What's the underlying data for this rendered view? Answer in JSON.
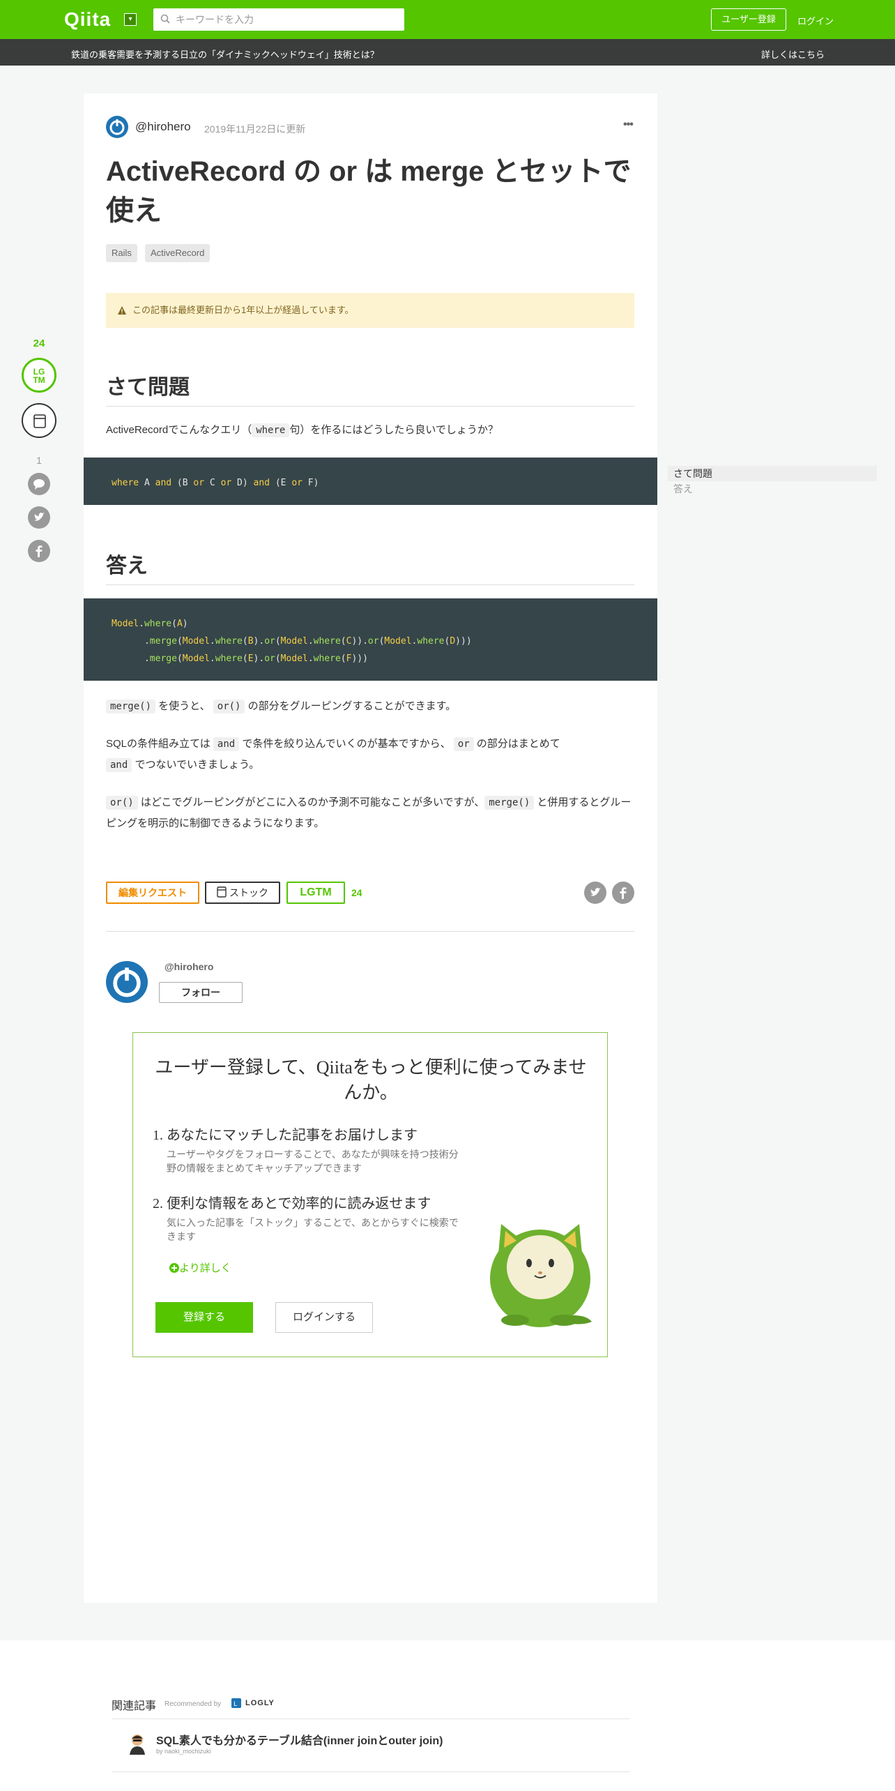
{
  "header": {
    "logo": "Qiita",
    "search_placeholder": "キーワードを入力",
    "signup_label": "ユーザー登録",
    "login_label": "ログイン",
    "brand_color": "#55c500"
  },
  "adbar": {
    "text": "鉄道の乗客需要を予測する日立の「ダイナミックヘッドウェイ」技術とは？",
    "link": "詳しくはこちら"
  },
  "rail": {
    "lgtm_count": "24",
    "lgtm_icon_text_1": "LG",
    "lgtm_icon_text_2": "TM",
    "comment_count": "1",
    "icons": [
      "comment-icon",
      "twitter-icon",
      "facebook-icon"
    ]
  },
  "article": {
    "author": "@hirohero",
    "updated": "2019年11月22日に更新",
    "more": "•••",
    "title": "ActiveRecord の or は merge とセットで使え",
    "tags": [
      "Rails",
      "ActiveRecord"
    ],
    "alert": "この記事は最終更新日から1年以上が経過しています。",
    "section1_heading": "さて問題",
    "section1_para": {
      "before": "ActiveRecordでこんなクエリ（",
      "code": "where",
      "after": "句）を作るにはどうしたら良いでしょうか？"
    },
    "code1": {
      "where": "where",
      "a": " A ",
      "and1": "and",
      "p1": " (B ",
      "or1": "or",
      "c": " C ",
      "or2": "or",
      "d": " D) ",
      "and2": "and",
      "p2": " (E ",
      "or3": "or",
      "f": " F)"
    },
    "section2_heading": "答え",
    "code2": {
      "model": "Model",
      "dot": ".",
      "where": "where",
      "merge": "merge",
      "or": "or",
      "a": "A",
      "b": "B",
      "c": "C",
      "d": "D",
      "e": "E",
      "f": "F"
    },
    "para1": {
      "code1": "merge()",
      "text1": " を使うと、 ",
      "code2": "or()",
      "text2": " の部分をグルーピングすることができます。"
    },
    "para2": {
      "text1": "SQLの条件組み立ては ",
      "code1": "and",
      "text2": " で条件を絞り込んでいくのが基本ですから、 ",
      "code2": "or",
      "text3": " の部分はまとめて",
      "code3": "and",
      "text4": " でつないでいきましょう。"
    },
    "para3": {
      "code1": "or()",
      "text1": " はどこでグルーピングがどこに入るのか予測不可能なことが多いですが、",
      "code2": "merge()",
      "text2": " と併用するとグルーピングを明示的に制御できるようになります。"
    },
    "edit_request_label": "編集リクエスト",
    "stock_label": "ストック",
    "lgtm_label": "LGTM",
    "lgtm_count": "24",
    "author_card_name": "@hirohero",
    "follow_label": "フォロー"
  },
  "cta": {
    "title": "ユーザー登録して、Qiitaをもっと便利に使ってみませんか。",
    "item1_title": "1. あなたにマッチした記事をお届けします",
    "item1_desc": "ユーザーやタグをフォローすることで、あなたが興味を持つ技術分野の情報をまとめてキャッチアップできます",
    "item2_title": "2. 便利な情報をあとで効率的に読み返せます",
    "item2_desc": "気に入った記事を「ストック」することで、あとからすぐに検索できます",
    "more_label": "より詳しく",
    "register_label": "登録する",
    "login_label": "ログインする"
  },
  "toc": {
    "items": [
      "さて問題",
      "答え"
    ]
  },
  "related": {
    "heading": "関連記事",
    "recommended_by": "Recommended by",
    "provider": "LOGLY",
    "items": [
      {
        "title": "SQL素人でも分かるテーブル結合(inner joinとouter join)",
        "by": "by naoki_mochizuki"
      }
    ]
  }
}
